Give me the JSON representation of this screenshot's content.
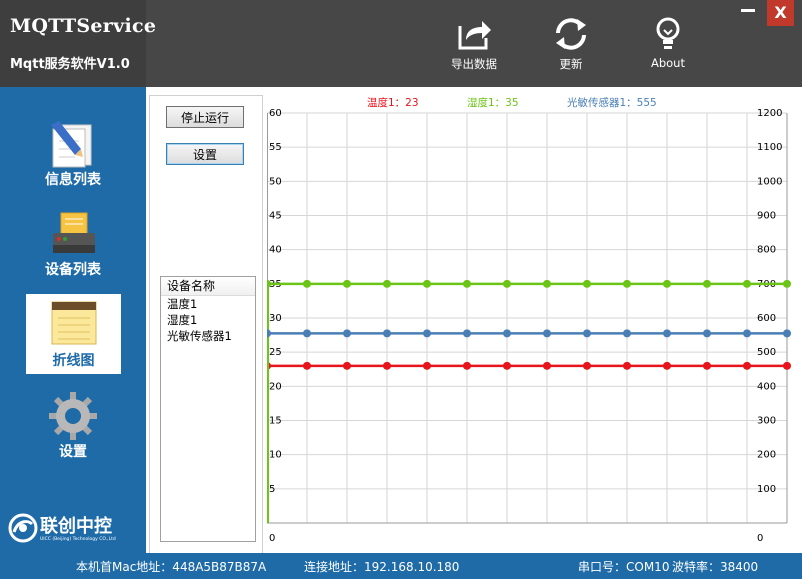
{
  "app": {
    "title": "MQTTService",
    "subtitle": "Mqtt服务软件V1.0"
  },
  "toolbar": {
    "export_label": "导出数据",
    "update_label": "更新",
    "about_label": "About",
    "close_label": "X"
  },
  "sidebar": {
    "items": [
      {
        "label": "信息列表",
        "icon": "document-pencil-icon"
      },
      {
        "label": "设备列表",
        "icon": "printer-icon"
      },
      {
        "label": "折线图",
        "icon": "notepad-icon"
      },
      {
        "label": "设置",
        "icon": "gear-icon"
      }
    ],
    "active_index": 2,
    "logo_name": "联创中控",
    "logo_sub": "UICC (Beijing) Technology CO.,Ltd"
  },
  "controls": {
    "stop_label": "停止运行",
    "settings_label": "设置"
  },
  "device_list": {
    "header": "设备名称",
    "items": [
      "温度1",
      "湿度1",
      "光敏传感器1"
    ]
  },
  "status": {
    "mac": "本机首Mac地址：448A5B87B87A",
    "conn": "连接地址：192.168.10.180",
    "port": "串口号：COM10",
    "baud": "波特率：38400"
  },
  "colors": {
    "header_bg": "#474747",
    "sidebar_bg": "#1e6ba8",
    "close_bg": "#c0392b",
    "temp": "#e8141c",
    "humidity": "#6cc417",
    "light": "#4a7fb5"
  },
  "chart_data": {
    "type": "line",
    "x": [
      0,
      1,
      2,
      3,
      4,
      5,
      6,
      7,
      8,
      9,
      10,
      11,
      12,
      13
    ],
    "left_ylim": [
      0,
      60
    ],
    "left_ticks": [
      0,
      5,
      10,
      15,
      20,
      25,
      30,
      35,
      40,
      45,
      50,
      55,
      60
    ],
    "right_ylim": [
      0,
      1200
    ],
    "right_ticks": [
      0,
      100,
      200,
      300,
      400,
      500,
      600,
      700,
      800,
      900,
      1000,
      1100,
      1200
    ],
    "grid": true,
    "legend_position": "top",
    "series": [
      {
        "legend": "温度1：23",
        "axis": "left",
        "color": "#e8141c",
        "values": [
          23,
          23,
          23,
          23,
          23,
          23,
          23,
          23,
          23,
          23,
          23,
          23,
          23,
          23
        ]
      },
      {
        "legend": "湿度1：35",
        "axis": "left",
        "color": "#6cc417",
        "values": [
          35,
          35,
          35,
          35,
          35,
          35,
          35,
          35,
          35,
          35,
          35,
          35,
          35,
          35
        ]
      },
      {
        "legend": "光敏传感器1：555",
        "axis": "right",
        "color": "#4a7fb5",
        "values": [
          555,
          555,
          555,
          555,
          555,
          555,
          555,
          555,
          555,
          555,
          555,
          555,
          555,
          555
        ]
      }
    ]
  }
}
